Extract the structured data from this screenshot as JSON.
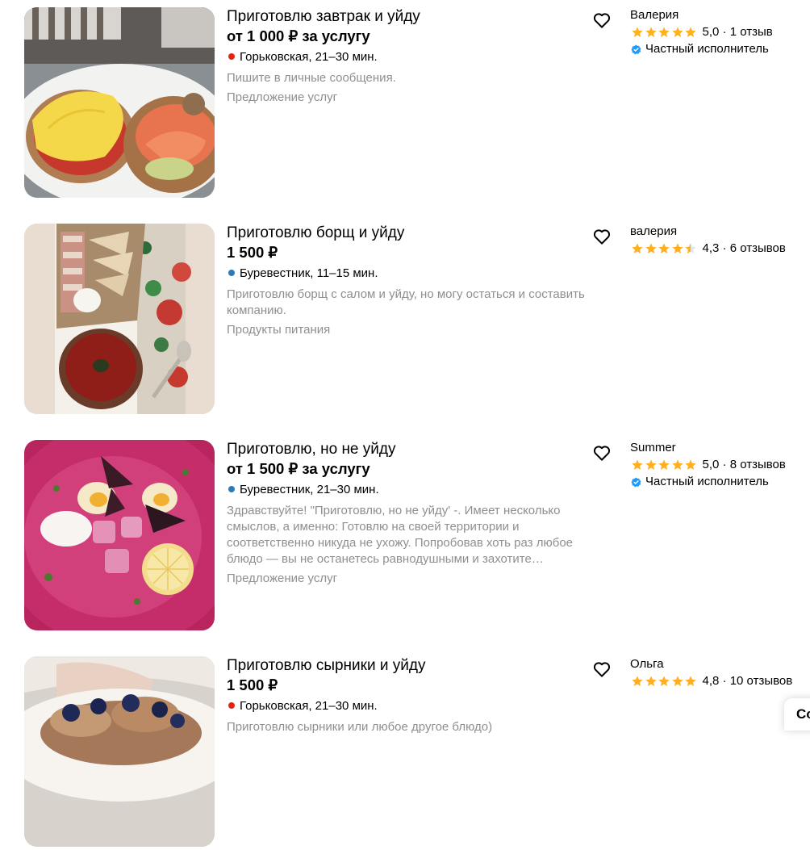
{
  "listings": [
    {
      "title": "Приготовлю завтрак и уйду",
      "price": "от 1 000 ₽ за услугу",
      "metro": "Горьковская, 21–30 мин.",
      "metro_color": "#e42313",
      "description": "Пишите в личные сообщения.",
      "category": "Предложение услуг",
      "seller": "Валерия",
      "rating": "5,0",
      "reviews": "1 отзыв",
      "rating_stars": 5,
      "verified_label": "Частный исполнитель",
      "photo_icon": "breakfast-photo"
    },
    {
      "title": "Приготовлю борщ и уйду",
      "price": "1 500 ₽",
      "metro": "Буревестник, 11–15 мин.",
      "metro_color": "#2a7bb8",
      "description": "Приготовлю борщ с салом и уйду, но могу остаться и составить компанию.",
      "category": "Продукты питания",
      "seller": "валерия",
      "rating": "4,3",
      "reviews": "6 отзывов",
      "rating_stars": 4.3,
      "photo_icon": "borscht-photo"
    },
    {
      "title": "Приготовлю, но не уйду",
      "price": "от 1 500 ₽ за услугу",
      "metro": "Буревестник, 21–30 мин.",
      "metro_color": "#2a7bb8",
      "description": "Здравствуйте! \"Приготовлю, но не уйду' -. Имеет несколько смыслов, а именно: Готовлю на своей территории и соответственно никуда не ухожу. Попробовав хоть раз любое блюдо — вы не останетесь равнодушными и захотите…",
      "category": "Предложение услуг",
      "seller": "Summer",
      "rating": "5,0",
      "reviews": "8 отзывов",
      "rating_stars": 5,
      "verified_label": "Частный исполнитель",
      "photo_icon": "cold-soup-photo"
    },
    {
      "title": "Приготовлю сырники и уйду",
      "price": "1 500 ₽",
      "metro": "Горьковская, 21–30 мин.",
      "metro_color": "#e42313",
      "description": "Приготовлю сырники или любое другое блюдо)",
      "seller": "Ольга",
      "rating": "4,8",
      "reviews": "10 отзывов",
      "rating_stars": 5,
      "photo_icon": "syrniki-photo"
    }
  ],
  "icons": {
    "favorite": "heart-outline-icon",
    "star": "star-icon",
    "verified": "verified-check-icon"
  },
  "floating_button": {
    "label": "Co"
  },
  "colors": {
    "star": "#ffb021",
    "verified": "#1e9bff",
    "muted": "#8f8f8f"
  }
}
